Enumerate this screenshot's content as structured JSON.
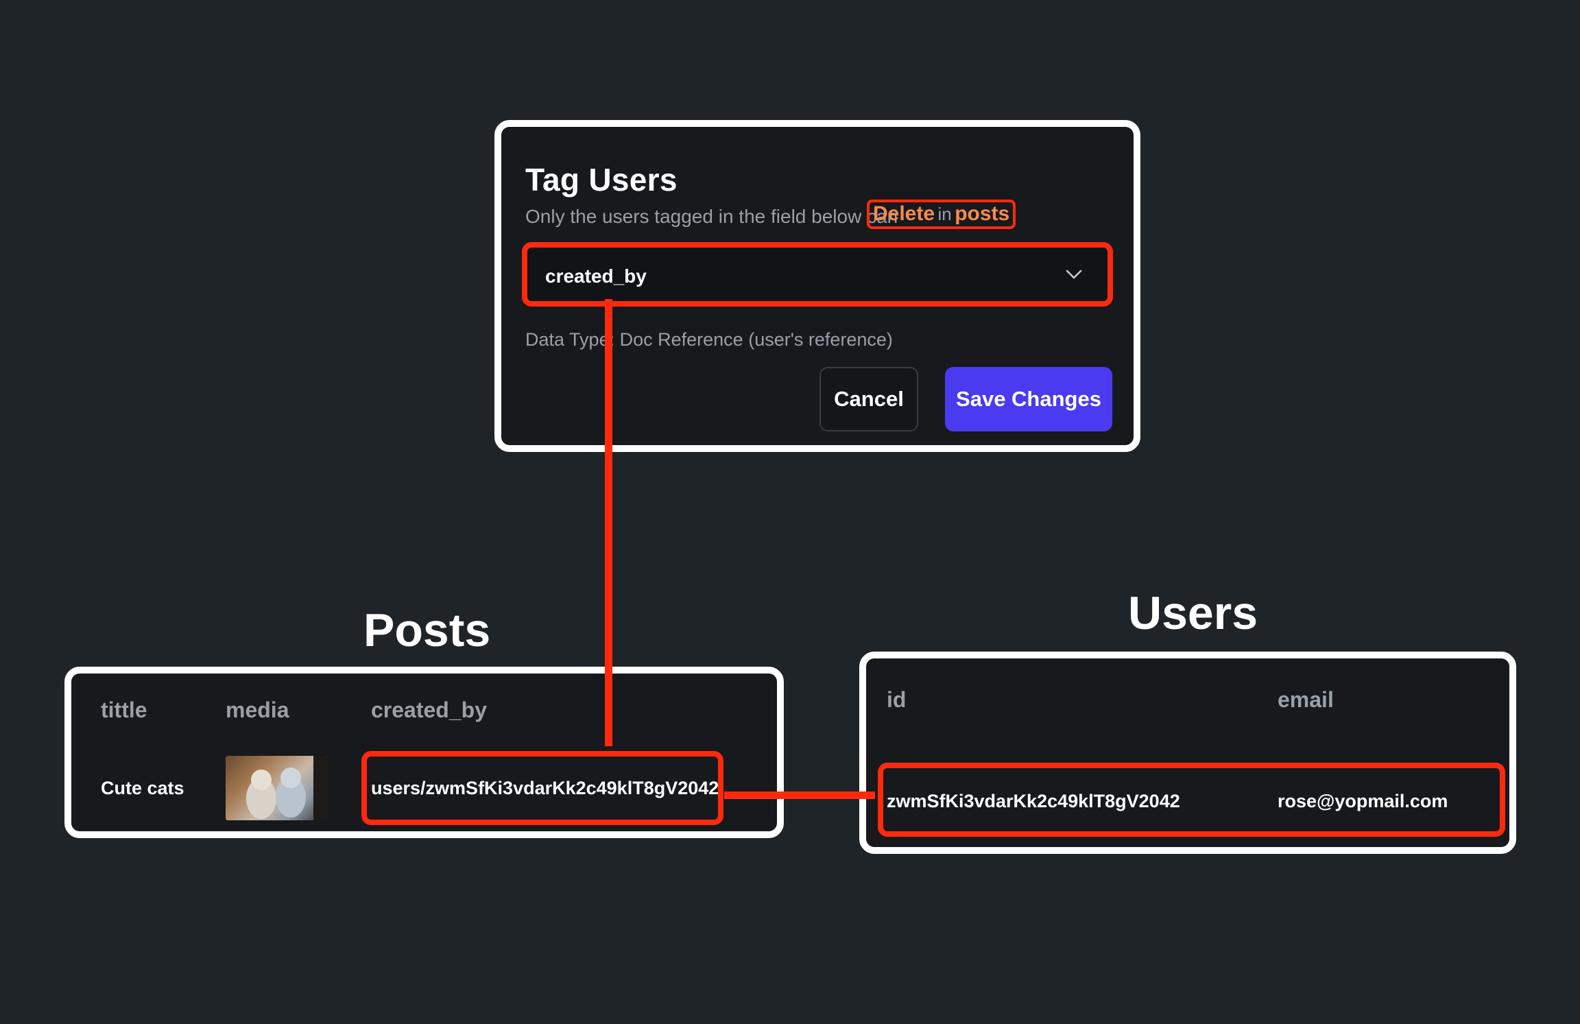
{
  "dialog": {
    "title": "Tag Users",
    "subtitle_prefix": "Only the users tagged in the field below can",
    "highlight_action": "Delete",
    "highlight_in": "in",
    "highlight_collection": "posts",
    "field_value": "created_by",
    "field_icon": "chevron-down-icon",
    "data_type_label": "Data Type:",
    "data_type_value": "Doc Reference (user's reference)",
    "cancel_label": "Cancel",
    "save_label": "Save Changes"
  },
  "posts": {
    "title": "Posts",
    "columns": [
      "tittle",
      "media",
      "created_by"
    ],
    "rows": [
      {
        "tittle": "Cute cats",
        "media": "cats-photo",
        "created_by": "users/zwmSfKi3vdarKk2c49klT8gV2042"
      }
    ]
  },
  "users": {
    "title": "Users",
    "columns": [
      "id",
      "email"
    ],
    "rows": [
      {
        "id": "zwmSfKi3vdarKk2c49klT8gV2042",
        "email": "rose@yopmail.com"
      }
    ]
  },
  "colors": {
    "background": "#1f2428",
    "panel": "#17191c",
    "highlight": "#ff2a0d",
    "accent_text": "#ff8a4a",
    "primary_button": "#4a3af0"
  }
}
